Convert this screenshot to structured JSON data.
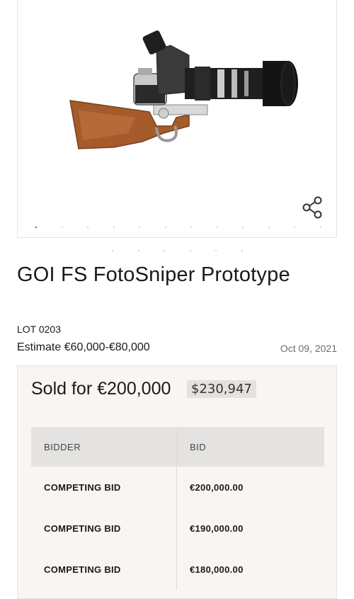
{
  "lot": {
    "title": "GOI FS FotoSniper Prototype",
    "lot_number": "LOT 0203",
    "estimate": "Estimate €60,000-€80,000",
    "date": "Oct 09, 2021"
  },
  "gallery": {
    "image_alt": "FotoSniper camera on wooden rifle stock",
    "share_icon": "share-icon",
    "slide_count": 12,
    "active_slide": 0,
    "outer_dot_count": 6
  },
  "sale": {
    "sold_label": "Sold for €200,000",
    "usd_value": "$230,947"
  },
  "bids_table": {
    "headers": [
      "BIDDER",
      "BID"
    ],
    "rows": [
      [
        "COMPETING BID",
        "€200,000.00"
      ],
      [
        "COMPETING BID",
        "€190,000.00"
      ],
      [
        "COMPETING BID",
        "€180,000.00"
      ]
    ]
  },
  "colors": {
    "sold_background": "#f9f5f2",
    "table_header": "#e5e3e1",
    "stock_wood": "#a45a2a",
    "camera_black": "#1c1c1c"
  }
}
